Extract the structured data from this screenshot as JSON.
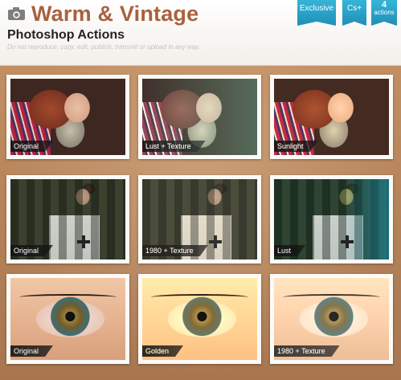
{
  "header": {
    "title": "Warm & Vintage",
    "subtitle": "Photoshop Actions",
    "disclaimer": "Do not reproduce, copy, edit, publish, transmit or upload in any way.",
    "ribbons": {
      "exclusive": "Exclusive",
      "version": "Cs+",
      "count_number": "4",
      "count_word": "actions"
    },
    "accent_color": "#a8623d",
    "ribbon_color": "#2aa3cb"
  },
  "grid": {
    "row1": [
      "Original",
      "Lust + Texture",
      "Sunlight"
    ],
    "row2": [
      "Original",
      "1980 + Texture",
      "Lust"
    ],
    "row3": [
      "Original",
      "Golden",
      "1980 + Texture"
    ]
  }
}
